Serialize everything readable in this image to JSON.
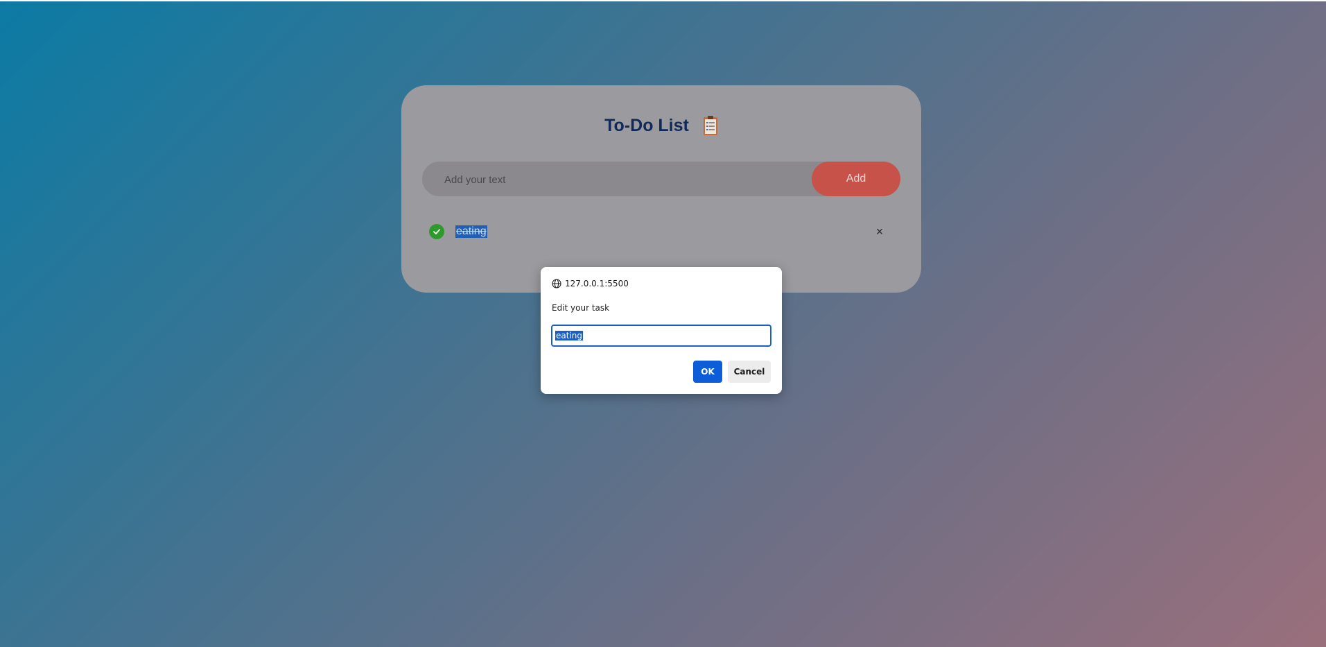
{
  "app": {
    "title": "To-Do List",
    "input_placeholder": "Add your text",
    "add_label": "Add",
    "tasks": [
      {
        "text": "eating",
        "completed": true
      }
    ],
    "delete_symbol": "×"
  },
  "dialog": {
    "origin": "127.0.0.1:5500",
    "message": "Edit your task",
    "input_value": "eating",
    "ok_label": "OK",
    "cancel_label": "Cancel"
  },
  "colors": {
    "title": "#0f2a5a",
    "add_button": "#c6524a",
    "check": "#2e9a2b",
    "ok_button": "#0b5ed7"
  },
  "icons": {
    "clipboard": "clipboard-icon",
    "check": "check-icon",
    "delete": "close-icon",
    "globe": "globe-icon"
  }
}
